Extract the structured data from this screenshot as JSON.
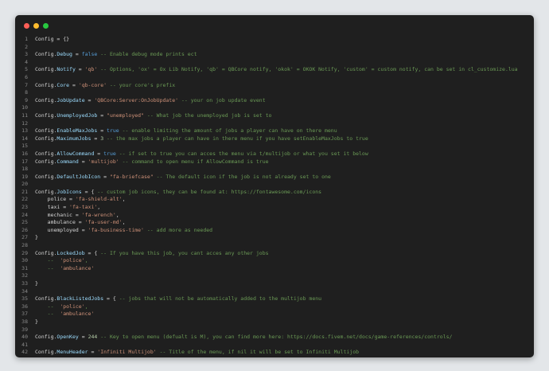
{
  "window": {
    "lines": [
      {
        "n": "1",
        "tokens": [
          [
            "plain",
            "Config = {}"
          ]
        ]
      },
      {
        "n": "2",
        "tokens": []
      },
      {
        "n": "3",
        "tokens": [
          [
            "plain",
            "Config."
          ],
          [
            "key",
            "Debug"
          ],
          [
            "plain",
            " = "
          ],
          [
            "kw",
            "false"
          ],
          [
            "com",
            " -- Enable debug mode prints ect"
          ]
        ]
      },
      {
        "n": "4",
        "tokens": []
      },
      {
        "n": "5",
        "tokens": [
          [
            "plain",
            "Config."
          ],
          [
            "key",
            "Notify"
          ],
          [
            "plain",
            " = "
          ],
          [
            "str",
            "'qb'"
          ],
          [
            "com",
            " -- Options, 'ox' = Ox Lib Notify, 'qb' = QBCore notify, 'okok' = OKOK Notify, 'custom' = custom notify, can be set in cl_customize.lua"
          ]
        ]
      },
      {
        "n": "6",
        "tokens": []
      },
      {
        "n": "7",
        "tokens": [
          [
            "plain",
            "Config."
          ],
          [
            "key",
            "Core"
          ],
          [
            "plain",
            " = "
          ],
          [
            "str",
            "'qb-core'"
          ],
          [
            "com",
            " -- your core's prefix"
          ]
        ]
      },
      {
        "n": "8",
        "tokens": []
      },
      {
        "n": "9",
        "tokens": [
          [
            "plain",
            "Config."
          ],
          [
            "key",
            "JobUpdate"
          ],
          [
            "plain",
            " = "
          ],
          [
            "str",
            "'QBCore:Server:OnJobUpdate'"
          ],
          [
            "com",
            " -- your on job update event"
          ]
        ]
      },
      {
        "n": "10",
        "tokens": []
      },
      {
        "n": "11",
        "tokens": [
          [
            "plain",
            "Config."
          ],
          [
            "key",
            "UnemployedJob"
          ],
          [
            "plain",
            " = "
          ],
          [
            "str",
            "\"unemployed\""
          ],
          [
            "com",
            " -- What job the unemployed job is set to"
          ]
        ]
      },
      {
        "n": "12",
        "tokens": []
      },
      {
        "n": "13",
        "tokens": [
          [
            "plain",
            "Config."
          ],
          [
            "key",
            "EnableMaxJobs"
          ],
          [
            "plain",
            " = "
          ],
          [
            "kw",
            "true"
          ],
          [
            "com",
            " -- enable limiting the amount of jobs a player can have on there menu"
          ]
        ]
      },
      {
        "n": "14",
        "tokens": [
          [
            "plain",
            "Config."
          ],
          [
            "key",
            "MaximumJobs"
          ],
          [
            "plain",
            " = "
          ],
          [
            "num",
            "3"
          ],
          [
            "com",
            " -- the max jobs a player can have in there menu if you have setEnableMaxJobs to true"
          ]
        ]
      },
      {
        "n": "15",
        "tokens": []
      },
      {
        "n": "16",
        "tokens": [
          [
            "plain",
            "Config."
          ],
          [
            "key",
            "AllowCommand"
          ],
          [
            "plain",
            " = "
          ],
          [
            "kw",
            "true"
          ],
          [
            "com",
            " -- if set to true you can acces the menu via t/multijob or what you set it below"
          ]
        ]
      },
      {
        "n": "17",
        "tokens": [
          [
            "plain",
            "Config."
          ],
          [
            "key",
            "Command"
          ],
          [
            "plain",
            " = "
          ],
          [
            "str",
            "'multijob'"
          ],
          [
            "com",
            " -- command to open menu if AllowCommand is true"
          ]
        ]
      },
      {
        "n": "18",
        "tokens": []
      },
      {
        "n": "19",
        "tokens": [
          [
            "plain",
            "Config."
          ],
          [
            "key",
            "DefaultJobIcon"
          ],
          [
            "plain",
            " = "
          ],
          [
            "str",
            "\"fa-briefcase\""
          ],
          [
            "com",
            " -- The default icon if the job is not already set to one"
          ]
        ]
      },
      {
        "n": "20",
        "tokens": []
      },
      {
        "n": "21",
        "tokens": [
          [
            "plain",
            "Config."
          ],
          [
            "key",
            "JobIcons"
          ],
          [
            "plain",
            " = { "
          ],
          [
            "com",
            "-- custom job icons, they can be found at: https://fontawesome.com/icons"
          ]
        ]
      },
      {
        "n": "22",
        "tokens": [
          [
            "plain",
            "    police = "
          ],
          [
            "str",
            "'fa-shield-alt'"
          ],
          [
            "plain",
            ","
          ]
        ]
      },
      {
        "n": "23",
        "tokens": [
          [
            "plain",
            "    taxi = "
          ],
          [
            "str",
            "'fa-taxi'"
          ],
          [
            "plain",
            ","
          ]
        ]
      },
      {
        "n": "24",
        "tokens": [
          [
            "plain",
            "    mechanic = "
          ],
          [
            "str",
            "'fa-wrench'"
          ],
          [
            "plain",
            ","
          ]
        ]
      },
      {
        "n": "25",
        "tokens": [
          [
            "plain",
            "    ambulance = "
          ],
          [
            "str",
            "'fa-user-md'"
          ],
          [
            "plain",
            ","
          ]
        ]
      },
      {
        "n": "26",
        "tokens": [
          [
            "plain",
            "    unemployed = "
          ],
          [
            "str",
            "'fa-business-time'"
          ],
          [
            "com",
            " -- add more as needed"
          ]
        ]
      },
      {
        "n": "27",
        "tokens": [
          [
            "plain",
            "}"
          ]
        ]
      },
      {
        "n": "28",
        "tokens": []
      },
      {
        "n": "29",
        "tokens": [
          [
            "plain",
            "Config."
          ],
          [
            "key",
            "LockedJob"
          ],
          [
            "plain",
            " = { "
          ],
          [
            "com",
            "-- If you have this job, you cant acces any other jobs"
          ]
        ]
      },
      {
        "n": "30",
        "tokens": [
          [
            "com",
            "    --  "
          ],
          [
            "str",
            "'police'"
          ],
          [
            "com",
            ","
          ]
        ]
      },
      {
        "n": "31",
        "tokens": [
          [
            "com",
            "    --  "
          ],
          [
            "str",
            "'ambulance'"
          ]
        ]
      },
      {
        "n": "32",
        "tokens": []
      },
      {
        "n": "33",
        "tokens": [
          [
            "plain",
            "}"
          ]
        ]
      },
      {
        "n": "34",
        "tokens": []
      },
      {
        "n": "35",
        "tokens": [
          [
            "plain",
            "Config."
          ],
          [
            "key",
            "BlackListedJobs"
          ],
          [
            "plain",
            " = { "
          ],
          [
            "com",
            "-- jobs that will not be automatically added to the multijob menu"
          ]
        ]
      },
      {
        "n": "36",
        "tokens": [
          [
            "com",
            "    --  "
          ],
          [
            "str",
            "'police'"
          ],
          [
            "com",
            ","
          ]
        ]
      },
      {
        "n": "37",
        "tokens": [
          [
            "com",
            "    --  "
          ],
          [
            "str",
            "'ambulance'"
          ]
        ]
      },
      {
        "n": "38",
        "tokens": [
          [
            "plain",
            "}"
          ]
        ]
      },
      {
        "n": "39",
        "tokens": []
      },
      {
        "n": "40",
        "tokens": [
          [
            "plain",
            "Config."
          ],
          [
            "key",
            "OpenKey"
          ],
          [
            "plain",
            " = "
          ],
          [
            "num",
            "244"
          ],
          [
            "com",
            " -- Key to open menu (defualt is M), you can find more here: https://docs.fivem.net/docs/game-references/controls/"
          ]
        ]
      },
      {
        "n": "41",
        "tokens": []
      },
      {
        "n": "42",
        "tokens": [
          [
            "plain",
            "Config."
          ],
          [
            "key",
            "MenuHeader"
          ],
          [
            "plain",
            " = "
          ],
          [
            "str",
            "'Infiniti Multijob'"
          ],
          [
            "com",
            " -- Title of the menu, if nil it will be set to Infiniti Multijob"
          ]
        ]
      }
    ]
  }
}
